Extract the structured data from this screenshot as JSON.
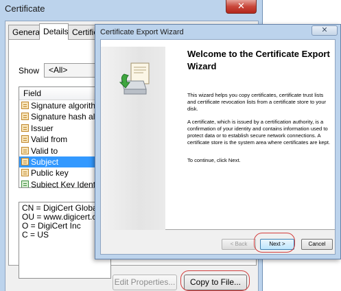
{
  "certificate": {
    "title": "Certificate",
    "close_label": "✕",
    "tabs": [
      "General",
      "Details",
      "Certification Path"
    ],
    "show_label": "Show",
    "show_value": "<All>",
    "field_header": "Field",
    "fields": [
      "Signature algorithm",
      "Signature hash algorithm",
      "Issuer",
      "Valid from",
      "Valid to",
      "Subject",
      "Public key",
      "Subject Key Identifier"
    ],
    "selected_field": "Subject",
    "value_lines": [
      "CN = DigiCert Global Root CA",
      "OU = www.digicert.com",
      "O = DigiCert Inc",
      "C = US"
    ],
    "edit_properties_label": "Edit Properties...",
    "copy_to_file_label": "Copy to File..."
  },
  "wizard": {
    "title": "Certificate Export Wizard",
    "close_label": "✕",
    "heading": "Welcome to the Certificate Export Wizard",
    "para1": "This wizard helps you copy certificates, certificate trust lists and certificate revocation lists from a certificate store to your disk.",
    "para2": "A certificate, which is issued by a certification authority, is a confirmation of your identity and contains information used to protect data or to establish secure network connections. A certificate store is the system area where certificates are kept.",
    "para3": "To continue, click Next.",
    "back_label": "< Back",
    "next_label": "Next >",
    "cancel_label": "Cancel"
  },
  "colors": {
    "highlight": "#d23c3c",
    "selection": "#3399ff",
    "window_frame": "#bcd3ec"
  }
}
